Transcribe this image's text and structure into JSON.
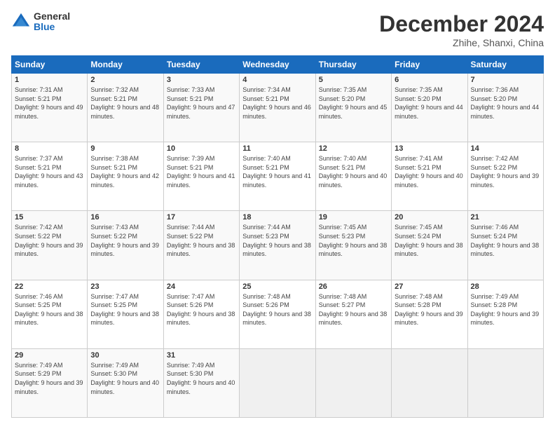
{
  "logo": {
    "general": "General",
    "blue": "Blue"
  },
  "header": {
    "month": "December 2024",
    "location": "Zhihe, Shanxi, China"
  },
  "days_of_week": [
    "Sunday",
    "Monday",
    "Tuesday",
    "Wednesday",
    "Thursday",
    "Friday",
    "Saturday"
  ],
  "weeks": [
    [
      {
        "day": "1",
        "sunrise": "7:31 AM",
        "sunset": "5:21 PM",
        "daylight": "9 hours and 49 minutes."
      },
      {
        "day": "2",
        "sunrise": "7:32 AM",
        "sunset": "5:21 PM",
        "daylight": "9 hours and 48 minutes."
      },
      {
        "day": "3",
        "sunrise": "7:33 AM",
        "sunset": "5:21 PM",
        "daylight": "9 hours and 47 minutes."
      },
      {
        "day": "4",
        "sunrise": "7:34 AM",
        "sunset": "5:21 PM",
        "daylight": "9 hours and 46 minutes."
      },
      {
        "day": "5",
        "sunrise": "7:35 AM",
        "sunset": "5:20 PM",
        "daylight": "9 hours and 45 minutes."
      },
      {
        "day": "6",
        "sunrise": "7:35 AM",
        "sunset": "5:20 PM",
        "daylight": "9 hours and 44 minutes."
      },
      {
        "day": "7",
        "sunrise": "7:36 AM",
        "sunset": "5:20 PM",
        "daylight": "9 hours and 44 minutes."
      }
    ],
    [
      {
        "day": "8",
        "sunrise": "7:37 AM",
        "sunset": "5:21 PM",
        "daylight": "9 hours and 43 minutes."
      },
      {
        "day": "9",
        "sunrise": "7:38 AM",
        "sunset": "5:21 PM",
        "daylight": "9 hours and 42 minutes."
      },
      {
        "day": "10",
        "sunrise": "7:39 AM",
        "sunset": "5:21 PM",
        "daylight": "9 hours and 41 minutes."
      },
      {
        "day": "11",
        "sunrise": "7:40 AM",
        "sunset": "5:21 PM",
        "daylight": "9 hours and 41 minutes."
      },
      {
        "day": "12",
        "sunrise": "7:40 AM",
        "sunset": "5:21 PM",
        "daylight": "9 hours and 40 minutes."
      },
      {
        "day": "13",
        "sunrise": "7:41 AM",
        "sunset": "5:21 PM",
        "daylight": "9 hours and 40 minutes."
      },
      {
        "day": "14",
        "sunrise": "7:42 AM",
        "sunset": "5:22 PM",
        "daylight": "9 hours and 39 minutes."
      }
    ],
    [
      {
        "day": "15",
        "sunrise": "7:42 AM",
        "sunset": "5:22 PM",
        "daylight": "9 hours and 39 minutes."
      },
      {
        "day": "16",
        "sunrise": "7:43 AM",
        "sunset": "5:22 PM",
        "daylight": "9 hours and 39 minutes."
      },
      {
        "day": "17",
        "sunrise": "7:44 AM",
        "sunset": "5:22 PM",
        "daylight": "9 hours and 38 minutes."
      },
      {
        "day": "18",
        "sunrise": "7:44 AM",
        "sunset": "5:23 PM",
        "daylight": "9 hours and 38 minutes."
      },
      {
        "day": "19",
        "sunrise": "7:45 AM",
        "sunset": "5:23 PM",
        "daylight": "9 hours and 38 minutes."
      },
      {
        "day": "20",
        "sunrise": "7:45 AM",
        "sunset": "5:24 PM",
        "daylight": "9 hours and 38 minutes."
      },
      {
        "day": "21",
        "sunrise": "7:46 AM",
        "sunset": "5:24 PM",
        "daylight": "9 hours and 38 minutes."
      }
    ],
    [
      {
        "day": "22",
        "sunrise": "7:46 AM",
        "sunset": "5:25 PM",
        "daylight": "9 hours and 38 minutes."
      },
      {
        "day": "23",
        "sunrise": "7:47 AM",
        "sunset": "5:25 PM",
        "daylight": "9 hours and 38 minutes."
      },
      {
        "day": "24",
        "sunrise": "7:47 AM",
        "sunset": "5:26 PM",
        "daylight": "9 hours and 38 minutes."
      },
      {
        "day": "25",
        "sunrise": "7:48 AM",
        "sunset": "5:26 PM",
        "daylight": "9 hours and 38 minutes."
      },
      {
        "day": "26",
        "sunrise": "7:48 AM",
        "sunset": "5:27 PM",
        "daylight": "9 hours and 38 minutes."
      },
      {
        "day": "27",
        "sunrise": "7:48 AM",
        "sunset": "5:28 PM",
        "daylight": "9 hours and 39 minutes."
      },
      {
        "day": "28",
        "sunrise": "7:49 AM",
        "sunset": "5:28 PM",
        "daylight": "9 hours and 39 minutes."
      }
    ],
    [
      {
        "day": "29",
        "sunrise": "7:49 AM",
        "sunset": "5:29 PM",
        "daylight": "9 hours and 39 minutes."
      },
      {
        "day": "30",
        "sunrise": "7:49 AM",
        "sunset": "5:30 PM",
        "daylight": "9 hours and 40 minutes."
      },
      {
        "day": "31",
        "sunrise": "7:49 AM",
        "sunset": "5:30 PM",
        "daylight": "9 hours and 40 minutes."
      },
      null,
      null,
      null,
      null
    ]
  ]
}
